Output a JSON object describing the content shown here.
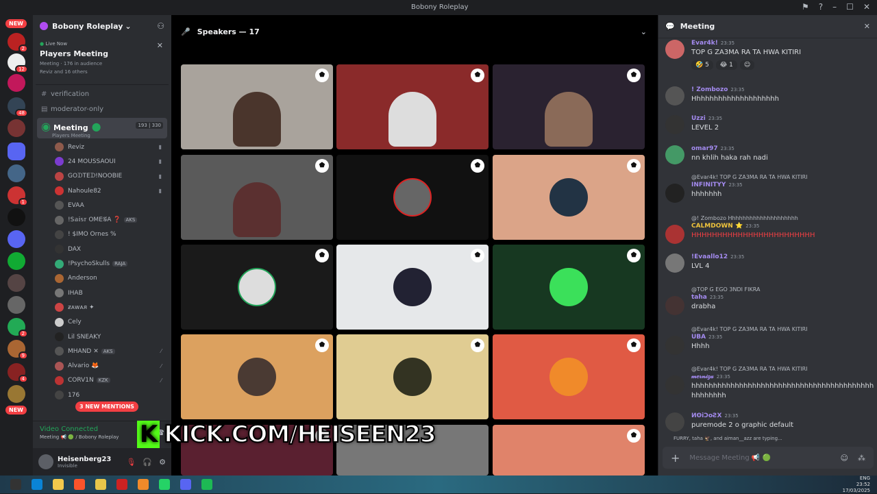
{
  "window": {
    "title": "Bobony Roleplay"
  },
  "guilds": {
    "new_top": "NEW",
    "new_bottom": "NEW",
    "badges": [
      "2",
      "12",
      "48",
      "1",
      "2",
      "9",
      "4",
      "3"
    ]
  },
  "server": {
    "name": "Bobony Roleplay"
  },
  "live": {
    "label": "Live Now",
    "title": "Players Meeting",
    "channel": "Meeting",
    "audience": "176 in audience",
    "people": "Reviz and 16 others"
  },
  "channels": [
    {
      "name": "verification"
    },
    {
      "name": "moderator-only"
    }
  ],
  "meeting": {
    "name": "Meeting",
    "sub": "Players Meeting",
    "count1": "193",
    "count2": "330"
  },
  "voice_users": [
    {
      "name": "Reviz",
      "color": "#8e5a4b"
    },
    {
      "name": "24 MOUSSAOUI",
      "color": "#7b3ccf"
    },
    {
      "name": "GOᗪTEᗪ!NOOBIE",
      "color": "#b44"
    },
    {
      "name": "Nahoule82",
      "color": "#c33"
    },
    {
      "name": "EVAA",
      "color": "#555"
    },
    {
      "name": "!S𝕒𝕚𝕤𝕣 ΟΜΕ𝒢Α ❓",
      "color": "#666",
      "tag": "AKS"
    },
    {
      "name": "! $IMO Ornes %",
      "color": "#444"
    },
    {
      "name": "DAX",
      "color": "#333"
    },
    {
      "name": "!PsychoSkulls",
      "color": "#3a7",
      "tag": "RAJA"
    },
    {
      "name": "Anderson",
      "color": "#a63"
    },
    {
      "name": "IHAB",
      "color": "#777"
    },
    {
      "name": "ƶᴀᴡᴀᴙ ✦",
      "color": "#c44"
    },
    {
      "name": "Cely",
      "color": "#ccc"
    },
    {
      "name": "Lil SNEAKY",
      "color": "#222"
    },
    {
      "name": "MHAND ✕",
      "color": "#555",
      "tag": "AKS"
    },
    {
      "name": "Alvario 🦊",
      "color": "#a55"
    },
    {
      "name": "CORV1N",
      "color": "#b33",
      "tag": "KZK"
    },
    {
      "name": "176",
      "color": "#444"
    }
  ],
  "mentions": "3 NEW MENTIONS",
  "voice": {
    "status": "Video Connected",
    "where": "Meeting 📢 🟢 / Bobony Roleplay"
  },
  "user": {
    "name": "Heisenberg23",
    "status": "Invisible"
  },
  "stage": {
    "header": "Speakers — 17"
  },
  "watermark": {
    "k": "K",
    "text": "KICK.COM/HEISEEN23"
  },
  "chat": {
    "title": "Meeting",
    "messages": [
      {
        "author": "Evar4k!",
        "color": "#a48bf0",
        "time": "23:35",
        "text": "TOP G ZA3MA RA TA HWA KITIRI",
        "reactions": [
          "🤣 5",
          "😂 1",
          "☺"
        ],
        "avatar": "#c66"
      },
      {
        "author": "! Zombozo",
        "color": "#a48bf0",
        "time": "23:35",
        "text": "Hhhhhhhhhhhhhhhhhhhh",
        "avatar": "#555"
      },
      {
        "author": "Uzzi",
        "color": "#a48bf0",
        "time": "23:35",
        "text": "LEVEL 2",
        "avatar": "#333"
      },
      {
        "author": "omar97",
        "color": "#a48bf0",
        "time": "23:35",
        "text": "nn khlih haka rah nadi",
        "avatar": "#496"
      },
      {
        "reply": "@Evar4k! TOP G ZA3MA RA TA HWA KITIRI",
        "author": "INFINITYY",
        "color": "#a48bf0",
        "time": "23:35",
        "text": "hhhhhhh",
        "avatar": "#222"
      },
      {
        "reply": "@! Zombozo Hhhhhhhhhhhhhhhhhhhh",
        "author": "CALMDOWN ⭐",
        "color": "#f0c43c",
        "time": "23:35",
        "text": "HHHHHHHHHHHHHHHHHHHHHHHH",
        "text_color": "#f23f43",
        "avatar": "#a33"
      },
      {
        "author": "!Evaallo12",
        "color": "#a48bf0",
        "time": "23:35",
        "text": "LVL 4",
        "avatar": "#777"
      },
      {
        "reply": "@TOP G EGO 3NDI FIKRA",
        "author": "taha",
        "color": "#a48bf0",
        "time": "23:35",
        "text": "drabha",
        "avatar": "#433"
      },
      {
        "reply": "@Evar4k! TOP G ZA3MA RA TA HWA KITIRI",
        "author": "UBA",
        "color": "#a48bf0",
        "time": "23:35",
        "text": "Hhhh",
        "avatar": "#333"
      },
      {
        "reply": "@Evar4k! TOP G ZA3MA RA TA HWA KITIRI",
        "author": "𝓂𝑒𝓇𝓃𝒾𝑔𝒶",
        "color": "#a48bf0",
        "time": "23:35",
        "text": "hhhhhhhhhhhhhhhhhhhhhhhhhhhhhhhhhhhhhhhhhh hhhhhhhh",
        "avatar": "#333"
      },
      {
        "author": "ИʘiƆoƧX",
        "color": "#a48bf0",
        "time": "23:35",
        "text": "puremode 2 o graphic default",
        "avatar": "#444"
      }
    ],
    "typing": "FURRY, taha 🦅, and aiman__azz are typing...",
    "placeholder": "Message Meeting 📢 🟢"
  },
  "taskbar": {
    "time": "23:52",
    "date": "17/03/2025",
    "lang": "ENG"
  }
}
